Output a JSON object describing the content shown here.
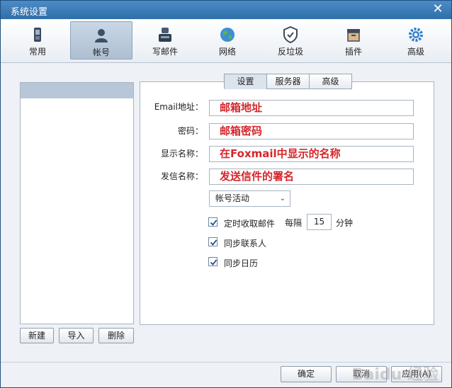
{
  "window": {
    "title": "系统设置"
  },
  "toolbar": {
    "items": [
      {
        "label": "常用",
        "icon": "phone-icon"
      },
      {
        "label": "帐号",
        "icon": "user-icon",
        "active": true
      },
      {
        "label": "写邮件",
        "icon": "write-mail-icon"
      },
      {
        "label": "网络",
        "icon": "globe-icon"
      },
      {
        "label": "反垃圾",
        "icon": "shield-icon"
      },
      {
        "label": "插件",
        "icon": "box-icon"
      },
      {
        "label": "高级",
        "icon": "gear-icon"
      }
    ]
  },
  "accounts": {
    "buttons": {
      "new": "新建",
      "import": "导入",
      "delete": "删除"
    }
  },
  "subtabs": [
    {
      "label": "设置",
      "active": true
    },
    {
      "label": "服务器"
    },
    {
      "label": "高级"
    }
  ],
  "form": {
    "email_label": "Email地址：",
    "email_value": "邮箱地址",
    "password_label": "密码：",
    "password_value": "邮箱密码",
    "display_label": "显示名称：",
    "display_value": "在Foxmail中显示的名称",
    "sender_label": "发信名称：",
    "sender_value": "发送信件的署名",
    "status_select": "帐号活动",
    "auto_receive_label": "定时收取邮件",
    "auto_receive_checked": true,
    "every_label": "每隔",
    "interval_value": "15",
    "minutes_label": "分钟",
    "sync_contacts_label": "同步联系人",
    "sync_contacts_checked": true,
    "sync_calendar_label": "同步日历",
    "sync_calendar_checked": true
  },
  "footer": {
    "ok": "确定",
    "cancel": "取消",
    "apply": "应用(A)"
  },
  "watermark": "Baidu 经验",
  "colors": {
    "title_bar": "#2f6fa8",
    "value_text": "#d4272b"
  }
}
